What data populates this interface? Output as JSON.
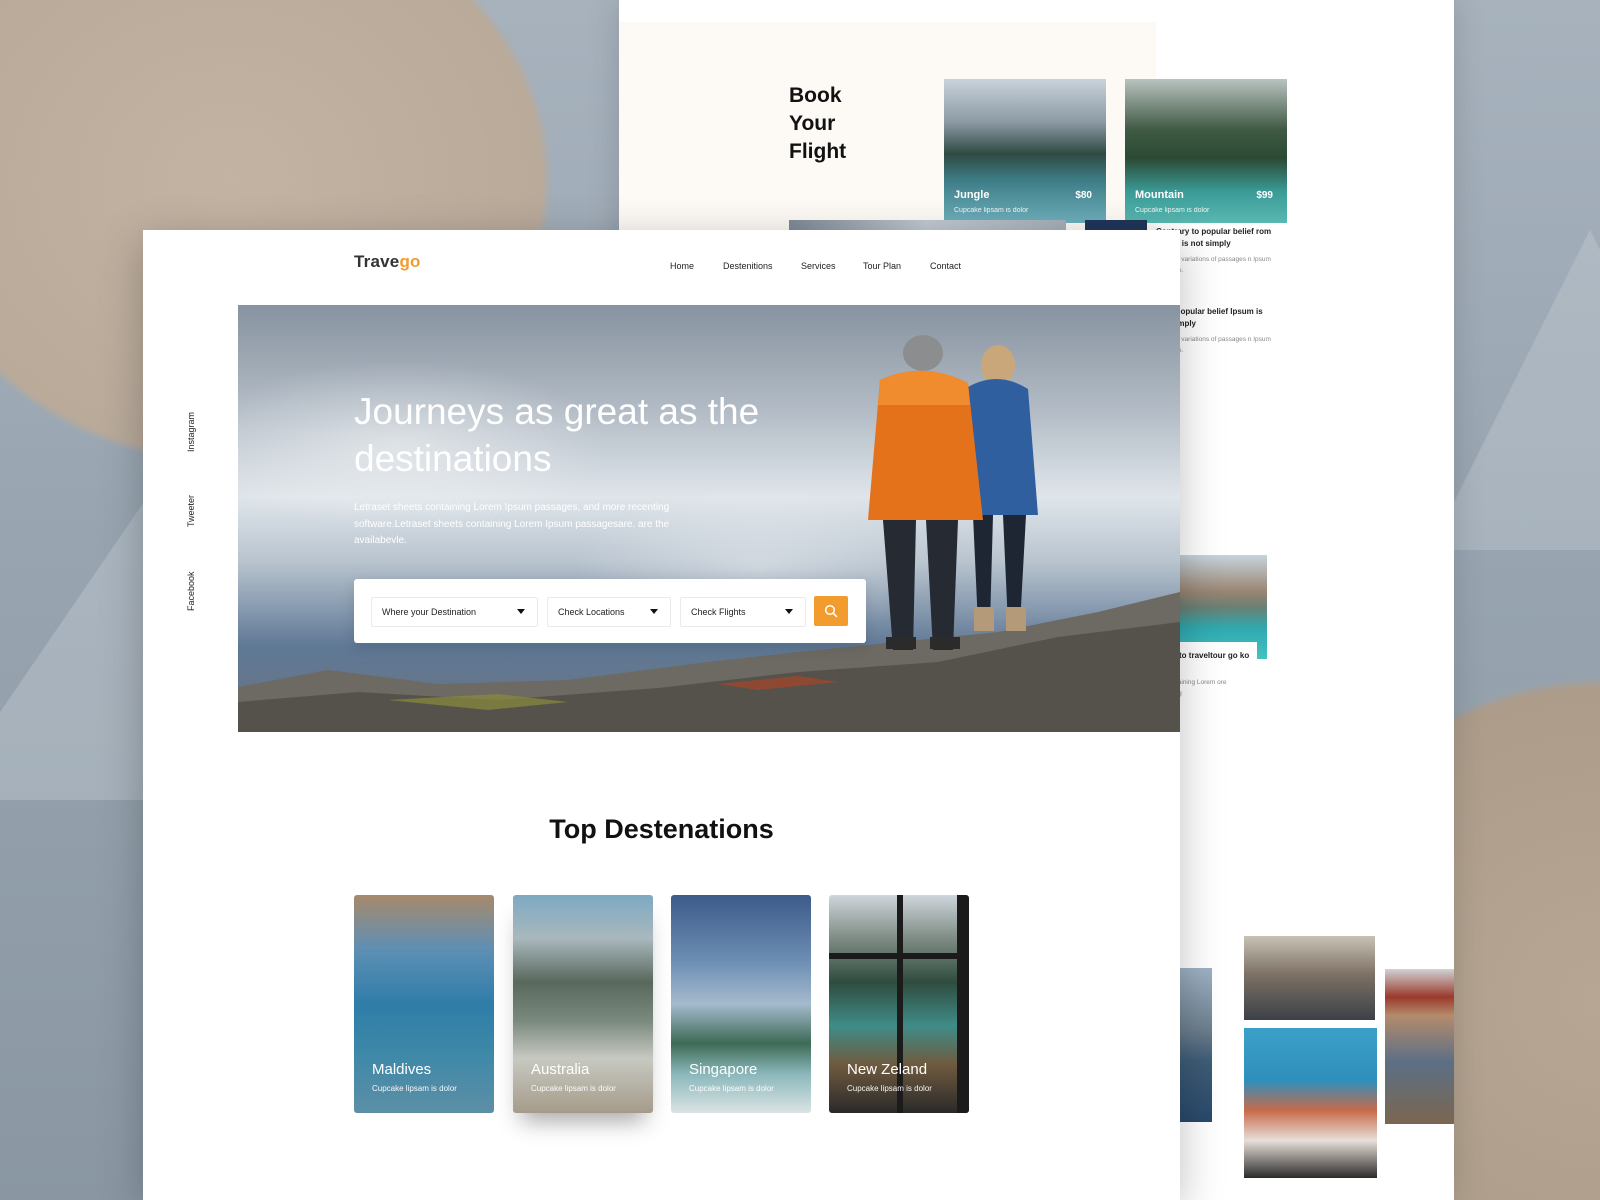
{
  "brand": {
    "name_main": "Trave",
    "name_accent": "go",
    "accent_color": "#f29b2e"
  },
  "nav": {
    "items": [
      "Home",
      "Destenitions",
      "Services",
      "Tour Plan",
      "Contact"
    ]
  },
  "social": [
    "Instagram",
    "Tweeter",
    "Facebook"
  ],
  "hero": {
    "title": "Journeys as great as the destinations",
    "description": "Letraset sheets containing Lorem Ipsum passages, and more recenting software.Letraset sheets containing Lorem Ipsum passagesare. are the availabevle."
  },
  "search": {
    "destination": "Where your Destination",
    "locations": "Check Locations",
    "flights": "Check Flights",
    "button_icon": "search-icon"
  },
  "top_destinations": {
    "title": "Top Destenations",
    "cards": [
      {
        "name": "Maldives",
        "sub": "Cupcake lipsam is dolor"
      },
      {
        "name": "Australia",
        "sub": "Cupcake lipsam is dolor"
      },
      {
        "name": "Singapore",
        "sub": "Cupcake lipsam is dolor"
      },
      {
        "name": "New Zeland",
        "sub": "Cupcake lipsam is dolor"
      }
    ]
  },
  "back_page": {
    "book_title": "Book\nYour\nFlight",
    "flights": [
      {
        "name": "Jungle",
        "price": "$80",
        "sub": "Cupcake lipsam is dolor"
      },
      {
        "name": "Mountain",
        "price": "$99",
        "sub": "Cupcake lipsam is dolor"
      }
    ],
    "promos": [
      {
        "title": "Contrary to popular belief rom Ipsum is not simply",
        "desc": "re many variations of passages n Ipsum available."
      },
      {
        "title": "ry to popular belief Ipsum is not simply",
        "desc": "re many variations of passages n Ipsum available."
      }
    ],
    "section_letter": "s",
    "card": {
      "title": "etreat to traveltour go ko",
      "desc": "ets containing Lorem ore recenting",
      "more": "ility"
    }
  }
}
